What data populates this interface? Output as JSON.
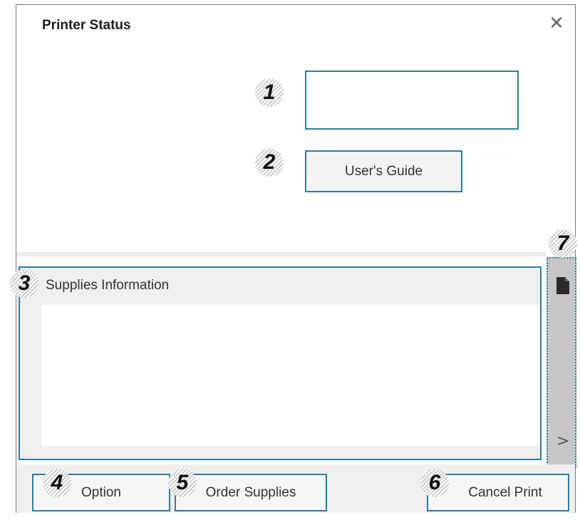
{
  "window": {
    "title": "Printer Status",
    "close_icon": "close-icon"
  },
  "top": {
    "status_value": "",
    "users_guide_label": "User's Guide"
  },
  "supplies": {
    "label": "Supplies Information"
  },
  "side_panel": {
    "document_icon": "document-icon",
    "expand_icon": "chevron-right-icon",
    "expand_glyph": ">"
  },
  "footer": {
    "option_label": "Option",
    "order_supplies_label": "Order Supplies",
    "cancel_print_label": "Cancel Print"
  },
  "callouts": [
    "1",
    "2",
    "3",
    "4",
    "5",
    "6",
    "7"
  ],
  "colors": {
    "accent_border": "#2b7ea0",
    "panel_bg": "#efefef",
    "side_panel_bg": "#c7c7c7"
  }
}
